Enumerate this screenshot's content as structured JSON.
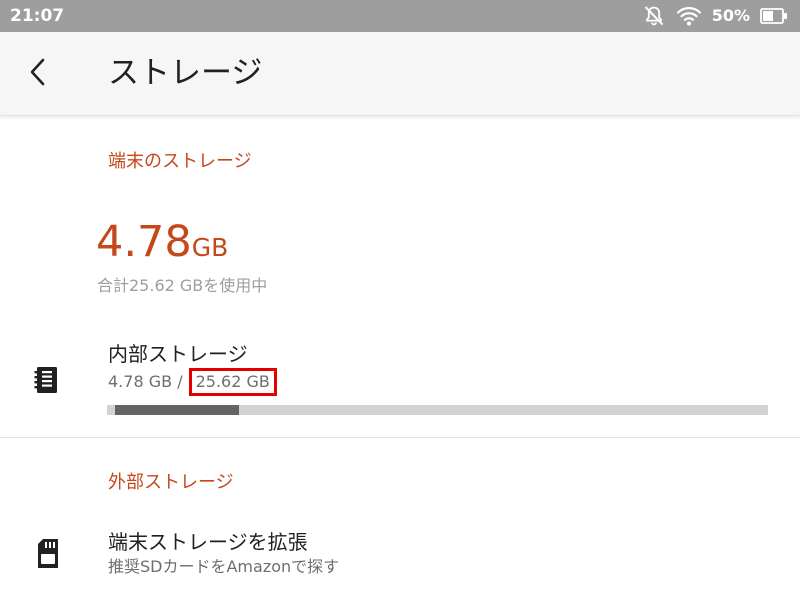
{
  "status_bar": {
    "time": "21:07",
    "battery_percent": "50%",
    "icons": [
      "notifications-off-icon",
      "wifi-icon",
      "battery-icon"
    ]
  },
  "app_bar": {
    "title": "ストレージ",
    "back_icon": "chevron-left-icon"
  },
  "device_storage": {
    "header": "端末のストレージ",
    "used_value": "4.78",
    "used_unit": "GB",
    "total_text": "合計25.62 GBを使用中"
  },
  "internal_storage": {
    "title": "内部ストレージ",
    "used": "4.78 GB",
    "separator": "/",
    "total": "25.62 GB",
    "icon": "storage-icon",
    "usage_fraction": 0.187
  },
  "external_storage": {
    "header": "外部ストレージ",
    "title": "端末ストレージを拡張",
    "subtitle": "推奨SDカードをAmazonで探す",
    "icon": "sd-card-icon"
  },
  "colors": {
    "accent": "#c5481b",
    "status_bar": "#9e9e9e",
    "highlight": "#e00000"
  }
}
